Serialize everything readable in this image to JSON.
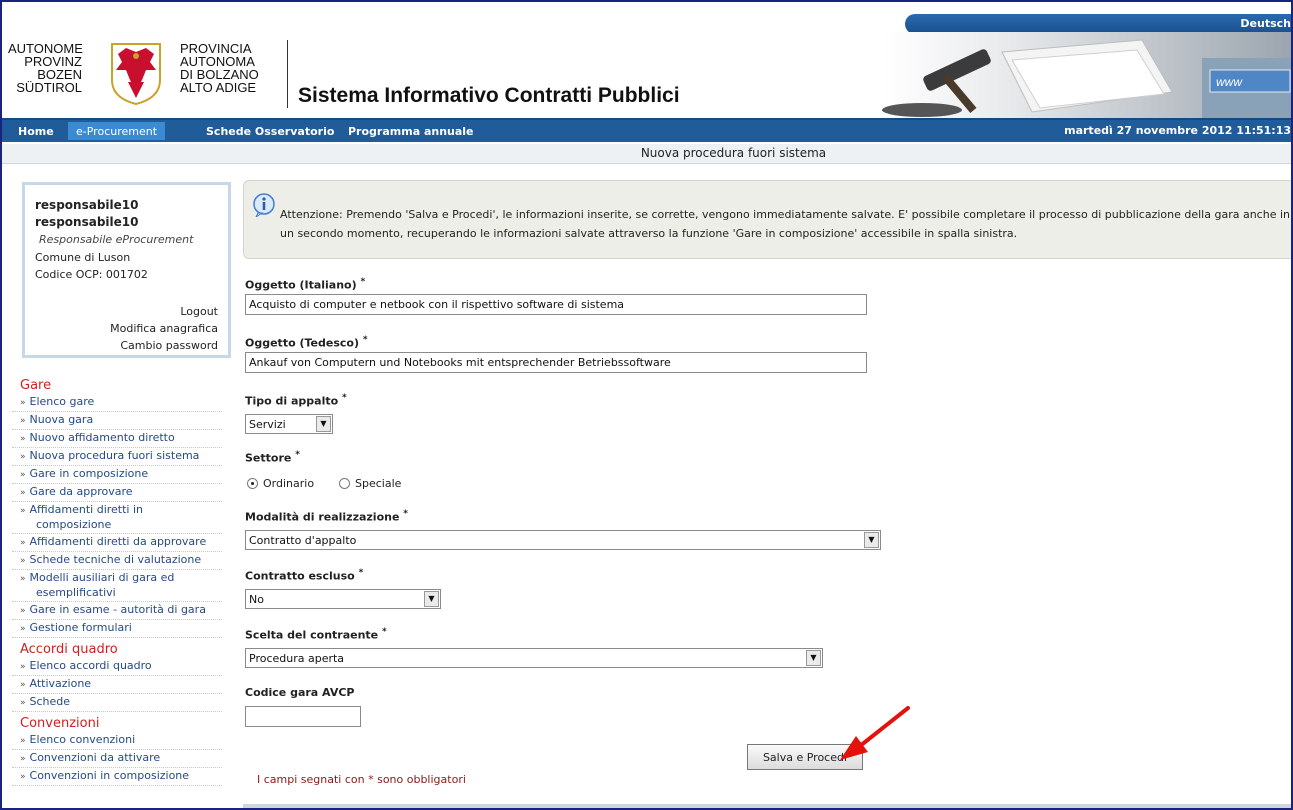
{
  "header": {
    "language_link": "Deutsch",
    "logo_left_lines": [
      "AUTONOME",
      "PROVINZ",
      "BOZEN",
      "SÜDTIROL"
    ],
    "logo_right_lines": [
      "PROVINCIA",
      "AUTONOMA",
      "DI BOLZANO",
      "ALTO ADIGE"
    ],
    "app_title": "Sistema Informativo Contratti Pubblici"
  },
  "nav": {
    "items": [
      "Home",
      "e-Procurement",
      "Schede Osservatorio",
      "Programma annuale"
    ],
    "active": "e-Procurement",
    "datetime": "martedì 27 novembre 2012 11:51:13"
  },
  "page_subtitle": "Nuova procedura fuori sistema",
  "user": {
    "name1": "responsabile10",
    "name2": "responsabile10",
    "role": "Responsabile eProcurement",
    "entity": "Comune di Luson",
    "code": "Codice OCP: 001702",
    "links": [
      "Logout",
      "Modifica anagrafica",
      "Cambio password"
    ]
  },
  "sidebar": {
    "sections": [
      {
        "heading": "Gare",
        "items": [
          [
            "Elenco gare"
          ],
          [
            "Nuova gara"
          ],
          [
            "Nuovo affidamento diretto"
          ],
          [
            "Nuova procedura fuori sistema"
          ],
          [
            "Gare in composizione"
          ],
          [
            "Gare da approvare"
          ],
          [
            "Affidamenti diretti in",
            "composizione"
          ],
          [
            "Affidamenti diretti da approvare"
          ],
          [
            "Schede tecniche di valutazione"
          ],
          [
            "Modelli ausiliari di gara ed",
            "esemplificativi"
          ],
          [
            "Gare in esame - autorità di gara"
          ],
          [
            "Gestione formulari"
          ]
        ]
      },
      {
        "heading": "Accordi quadro",
        "items": [
          [
            "Elenco accordi quadro"
          ],
          [
            "Attivazione"
          ],
          [
            "Schede"
          ]
        ]
      },
      {
        "heading": "Convenzioni",
        "items": [
          [
            "Elenco convenzioni"
          ],
          [
            "Convenzioni da attivare"
          ],
          [
            "Convenzioni in composizione"
          ]
        ]
      }
    ]
  },
  "notice": {
    "prefix": "Attenzione:",
    "text": "Premendo 'Salva e Procedi', le informazioni inserite, se corrette, vengono immediatamente salvate. E' possibile completare il processo di pubblicazione della gara anche in un secondo momento, recuperando le informazioni salvate attraverso la funzione 'Gare in composizione' accessibile in spalla sinistra."
  },
  "form": {
    "required_mark": "*",
    "oggetto_it": {
      "label": "Oggetto (Italiano)",
      "value": "Acquisto di computer e netbook con il rispettivo software di sistema"
    },
    "oggetto_de": {
      "label": "Oggetto (Tedesco)",
      "value": "Ankauf von Computern und Notebooks mit entsprechender Betriebssoftware"
    },
    "tipo_appalto": {
      "label": "Tipo di appalto",
      "value": "Servizi"
    },
    "settore": {
      "label": "Settore",
      "options": [
        "Ordinario",
        "Speciale"
      ],
      "selected": "Ordinario"
    },
    "modalita": {
      "label": "Modalità di realizzazione",
      "value": "Contratto d'appalto"
    },
    "contratto_escluso": {
      "label": "Contratto escluso",
      "value": "No"
    },
    "scelta_contraente": {
      "label": "Scelta del contraente",
      "value": "Procedura aperta"
    },
    "codice_avcp": {
      "label": "Codice gara AVCP",
      "value": ""
    },
    "submit_label": "Salva e Procedi",
    "required_note": "I campi segnati con * sono obbligatori"
  }
}
